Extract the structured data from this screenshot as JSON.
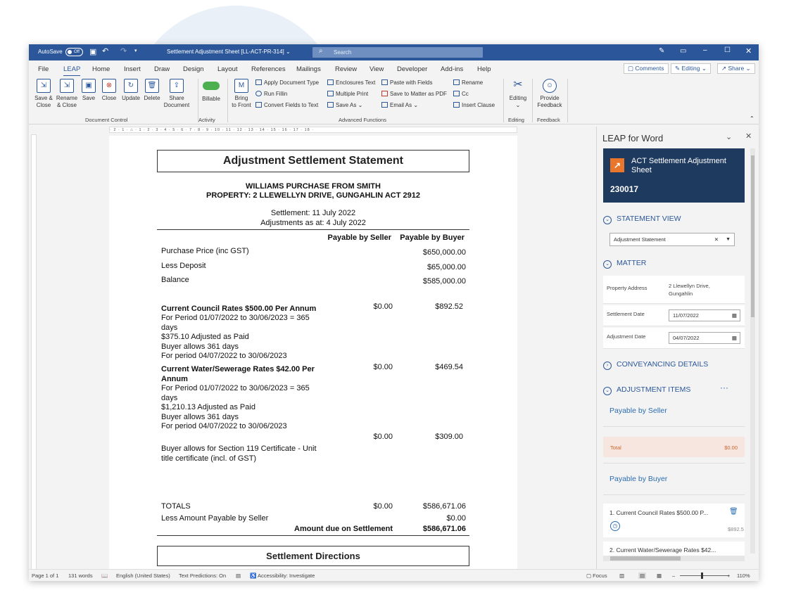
{
  "titlebar": {
    "autosave": "AutoSave",
    "toggle": "Off",
    "doc_title": "Settlement Adjustment Sheet [LL-ACT-PR-314] ⌄",
    "search": "Search"
  },
  "tabs": [
    "File",
    "LEAP",
    "Home",
    "Insert",
    "Draw",
    "Design",
    "Layout",
    "References",
    "Mailings",
    "Review",
    "View",
    "Developer",
    "Add-ins",
    "Help"
  ],
  "right_tabs": {
    "comments": "Comments",
    "editing": "Editing ⌄",
    "share": "Share ⌄"
  },
  "ribbon": {
    "doc_control": [
      "Save &\nClose",
      "Rename\n& Close",
      "Save",
      "Close",
      "Update",
      "Delete",
      "Share\nDocument"
    ],
    "billable": "Billable",
    "bring": "Bring\nto Front",
    "adv": [
      "Apply Document Type",
      "Run Fillin",
      "Convert Fields to Text",
      "Enclosures Text",
      "Multiple Print",
      "Save As ⌄",
      "Paste with Fields",
      "Save to Matter as PDF",
      "Email As ⌄",
      "Rename",
      "Cc",
      "Insert Clause"
    ],
    "editing": "Editing",
    "feedback": "Provide\nFeedback",
    "groups": [
      "Document Control",
      "Activity",
      "Advanced Functions",
      "Editing",
      "Feedback"
    ]
  },
  "ruler": "· 2 · 1 · ⌂ · 1 · 2 · 3 · 4 · 5 · 6 · 7 · 8 · 9 · 10 · 11 · 12 · 13 · 14 · 15 · 16 · 17 · 18 ·",
  "doc": {
    "title": "Adjustment Settlement Statement",
    "sub1": "WILLIAMS PURCHASE FROM SMITH",
    "sub2": "PROPERTY: 2 LLEWELLYN DRIVE, GUNGAHLIN ACT 2912",
    "settlement": "Settlement: 11 July 2022",
    "adjustments": "Adjustments as at: 4 July 2022",
    "col_seller": "Payable by Seller",
    "col_buyer": "Payable by Buyer",
    "rows": [
      {
        "label": "Purchase Price (inc GST)",
        "buyer": "$650,000.00"
      },
      {
        "label": "Less Deposit",
        "buyer": "$65,000.00"
      },
      {
        "label": "Balance",
        "buyer": "$585,000.00"
      }
    ],
    "items": [
      {
        "head": "Current Council Rates $500.00 Per Annum",
        "lines": "For Period 01/07/2022 to 30/06/2023 = 365\ndays\n$375.10 Adjusted as Paid\nBuyer allows 361 days\nFor period 04/07/2022 to 30/06/2023",
        "seller": "$0.00",
        "buyer": "$892.52"
      },
      {
        "head": "Current Water/Sewerage Rates $42.00 Per\nAnnum",
        "lines": "For Period 01/07/2022 to 30/06/2023 = 365\ndays\n$1,210.13 Adjusted as Paid\nBuyer allows 361 days\nFor period 04/07/2022 to 30/06/2023",
        "seller": "$0.00",
        "buyer": "$469.54"
      },
      {
        "head": "",
        "lines": "Buyer allows for Section 119 Certificate - Unit\ntitle certificate (incl. of GST)",
        "seller": "$0.00",
        "buyer": "$309.00"
      }
    ],
    "totals": "TOTALS",
    "totals_seller": "$0.00",
    "totals_buyer": "$586,671.06",
    "less": "Less Amount Payable by Seller",
    "less_buyer": "$0.00",
    "due": "Amount due on Settlement",
    "due_buyer": "$586,671.06",
    "directions": "Settlement Directions"
  },
  "status": {
    "page": "Page 1 of 1",
    "words": "131 words",
    "lang": "English (United States)",
    "pred": "Text Predictions: On",
    "access": "Accessibility: Investigate",
    "focus": "Focus",
    "zoom": "110%"
  },
  "pane": {
    "title": "LEAP for Word",
    "card_title": "ACT Settlement Adjustment\nSheet",
    "card_num": "230017",
    "statement_view": "STATEMENT VIEW",
    "select": "Adjustment Statement",
    "matter": "MATTER",
    "prop_label": "Property Address",
    "prop_val": "2 Llewellyn Drive,\nGungahlin",
    "sett_label": "Settlement Date",
    "sett_val": "11/07/2022",
    "adj_label": "Adjustment Date",
    "adj_val": "04/07/2022",
    "conv": "CONVEYANCING DETAILS",
    "adj_items": "ADJUSTMENT ITEMS",
    "pay_seller": "Payable by Seller",
    "total": "Total",
    "total_val": "$0.00",
    "pay_buyer": "Payable by Buyer",
    "item1": "1. Current Council Rates $500.00 P...",
    "item1_amt": "$892.5",
    "item2": "2. Current Water/Sewerage Rates $42..."
  },
  "colors": {
    "word_blue": "#2b579a",
    "leap_navy": "#1e3a5f",
    "leap_orange": "#e8762c",
    "total_bg": "#f7e6df"
  }
}
